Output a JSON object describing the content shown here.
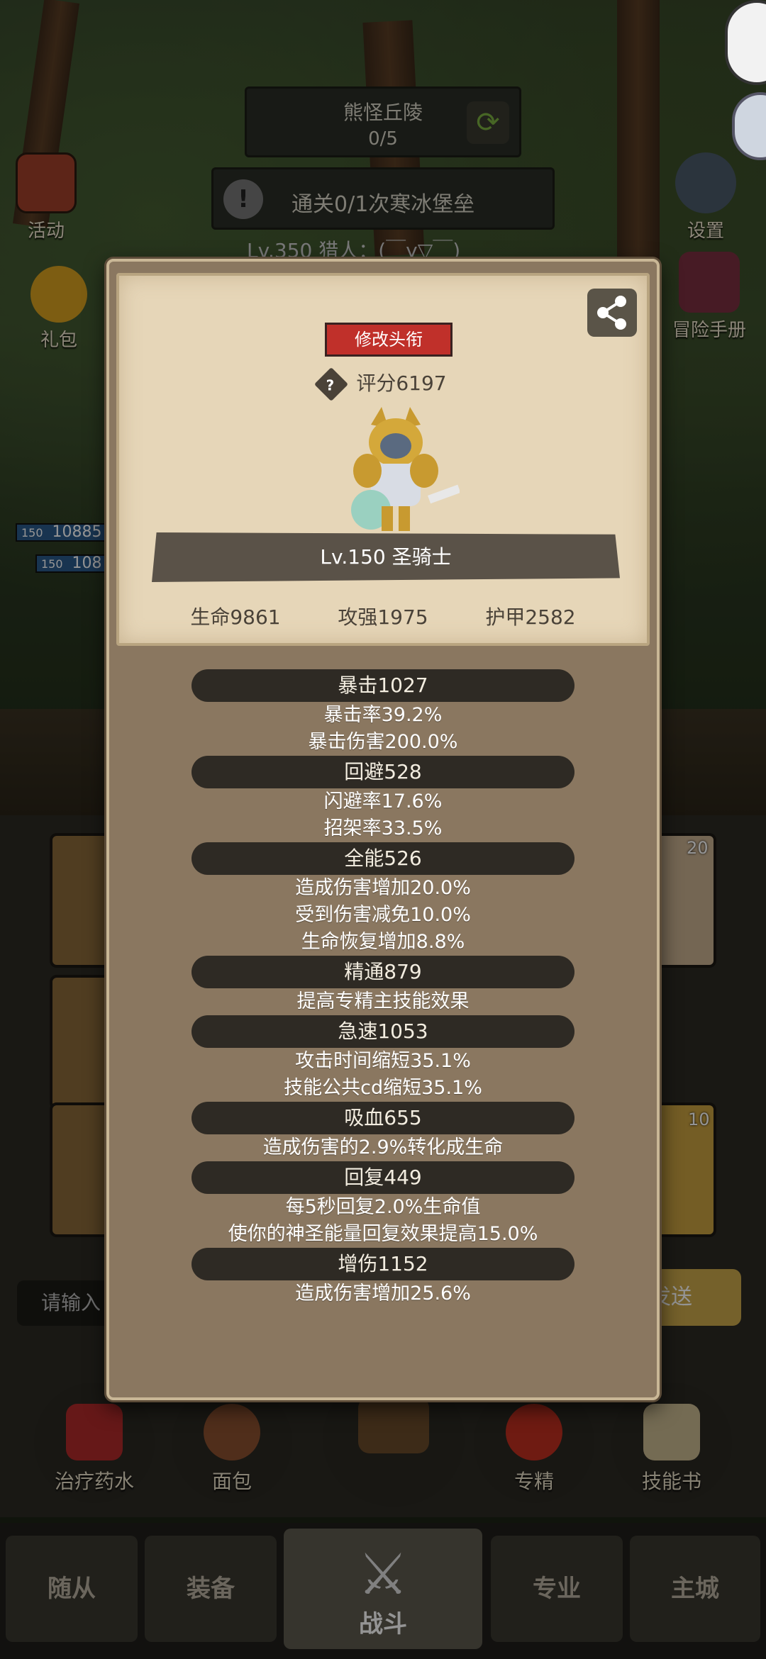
{
  "hud": {
    "zone_name": "熊怪丘陵",
    "zone_progress": "0/5",
    "quest_text": "通关0/1次寒冰堡垒",
    "player_line": "Lv.350 猎人：(￣y▽￣)",
    "left_buttons": [
      "活动",
      "礼包"
    ],
    "right_buttons": [
      "设置",
      "冒险手册"
    ],
    "hp_bars": [
      {
        "level": "150",
        "value": "10885"
      },
      {
        "level": "150",
        "value": "108"
      }
    ]
  },
  "modal": {
    "title_button": "修改头衔",
    "score": "评分6197",
    "hero_name": "Lv.150 圣骑士",
    "base_stats": [
      "生命9861",
      "攻强1975",
      "护甲2582"
    ],
    "stats": [
      {
        "head": "暴击1027",
        "lines": [
          "暴击率39.2%",
          "暴击伤害200.0%"
        ]
      },
      {
        "head": "回避528",
        "lines": [
          "闪避率17.6%",
          "招架率33.5%"
        ]
      },
      {
        "head": "全能526",
        "lines": [
          "造成伤害增加20.0%",
          "受到伤害减免10.0%",
          "生命恢复增加8.8%"
        ]
      },
      {
        "head": "精通879",
        "lines": [
          "提高专精主技能效果"
        ]
      },
      {
        "head": "急速1053",
        "lines": [
          "攻击时间缩短35.1%",
          "技能公共cd缩短35.1%"
        ]
      },
      {
        "head": "吸血655",
        "lines": [
          "造成伤害的2.9%转化成生命"
        ]
      },
      {
        "head": "回复449",
        "lines": [
          "每5秒回复2.0%生命值",
          "使你的神圣能量回复效果提高15.0%"
        ]
      },
      {
        "head": "增伤1152",
        "lines": [
          "造成伤害增加25.6%"
        ]
      }
    ]
  },
  "chat": {
    "placeholder": "请输入",
    "send": "发送"
  },
  "slots": {
    "count_top": "20",
    "count_bottom": "10"
  },
  "actions": [
    "治疗药水",
    "面包",
    "专精",
    "技能书"
  ],
  "tabs": [
    "随从",
    "装备",
    "战斗",
    "专业",
    "主城"
  ]
}
